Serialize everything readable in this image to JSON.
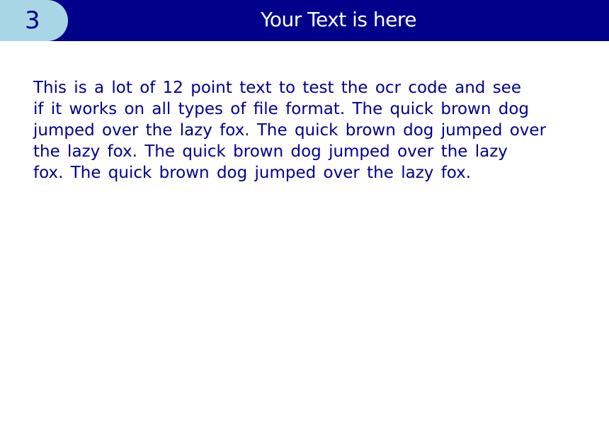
{
  "slide": {
    "number": "3",
    "title": "Your Text is here"
  },
  "body": {
    "lines": [
      "This is a lot of 12 point text to test the ocr code and see",
      "if it works on all types of file format. The quick brown dog",
      "jumped over the lazy fox. The quick brown dog jumped over",
      "the lazy fox. The quick brown dog jumped over the lazy",
      "fox. The quick brown dog jumped over the lazy fox."
    ]
  },
  "colors": {
    "header_background": "#00008b",
    "number_badge_background": "#a9d6e5",
    "text": "#00008b",
    "title_text": "#ffffff"
  }
}
